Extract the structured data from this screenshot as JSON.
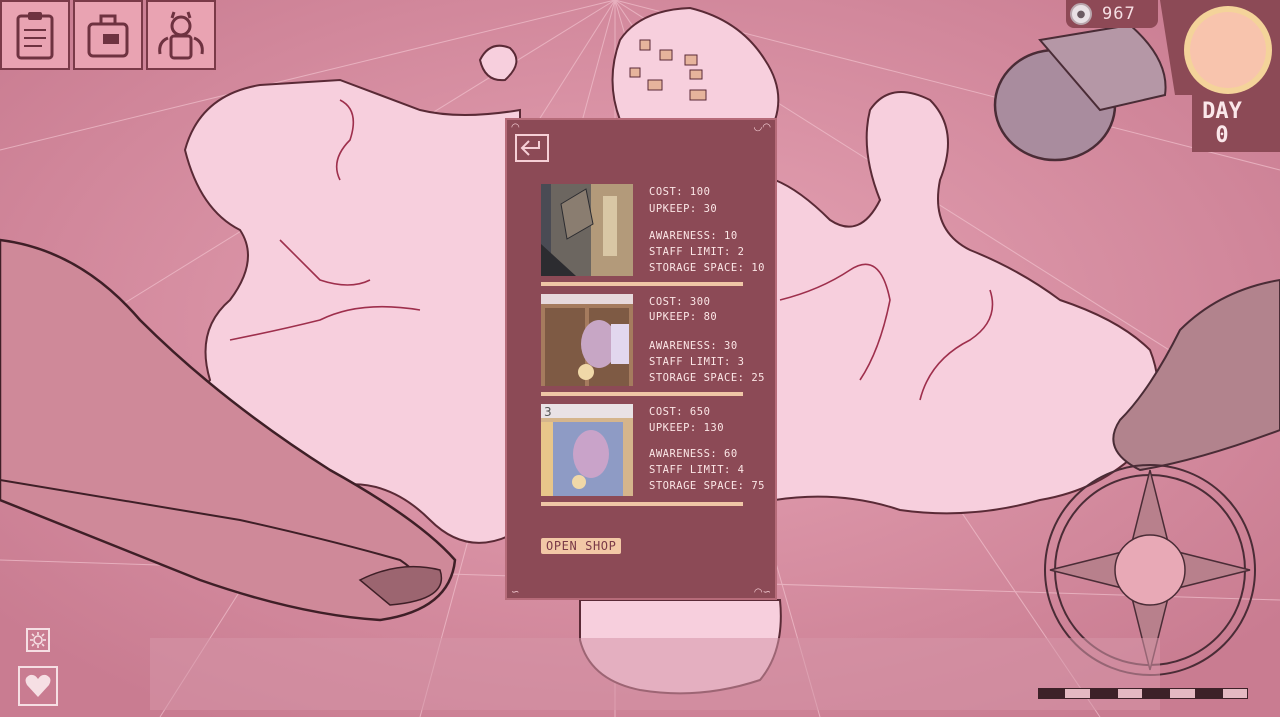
{
  "top_menu": {
    "clipboard_icon": "clipboard-icon",
    "suitcase_icon": "suitcase-icon",
    "character_icon": "winged-character-icon"
  },
  "currency": {
    "icon": "coin-icon",
    "value": "967"
  },
  "day_panel": {
    "label": "DAY",
    "value": "0"
  },
  "popup": {
    "back_icon": "return-arrow-icon",
    "options": [
      {
        "cost": "COST: 100",
        "upkeep": "UPKEEP: 30",
        "awareness": "AWARENESS: 10",
        "staff_limit": "STAFF LIMIT: 2",
        "storage": "STORAGE SPACE: 10"
      },
      {
        "cost": "COST: 300",
        "upkeep": "UPKEEP: 80",
        "awareness": "AWARENESS: 30",
        "staff_limit": "STAFF LIMIT: 3",
        "storage": "STORAGE SPACE: 25"
      },
      {
        "cost": "COST: 650",
        "upkeep": "UPKEEP: 130",
        "awareness": "AWARENESS: 60",
        "staff_limit": "STAFF LIMIT: 4",
        "storage": "STORAGE SPACE: 75"
      }
    ],
    "open_shop_label": "OPEN SHOP"
  },
  "bottom": {
    "settings_icon": "gear-icon",
    "heart_icon": "heart-icon",
    "time_progress_segments_filled": 4,
    "time_progress_segments_total": 8
  },
  "colors": {
    "map_background": "#d88fa3",
    "land": "#f7cfdd",
    "popup_bg": "#8c4a56",
    "accent": "#f2c8a6"
  }
}
